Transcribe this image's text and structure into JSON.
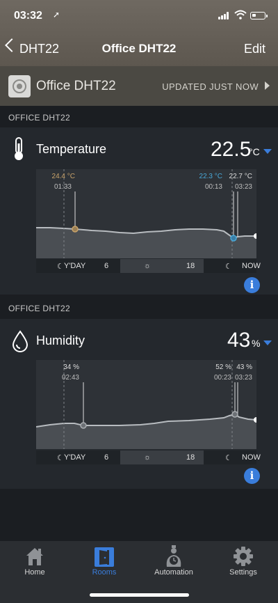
{
  "status": {
    "time": "03:32"
  },
  "nav": {
    "back_label": "DHT22",
    "title": "Office DHT22",
    "edit_label": "Edit"
  },
  "device": {
    "name": "Office DHT22",
    "updated": "UPDATED JUST NOW"
  },
  "temperature": {
    "section_label": "OFFICE DHT22",
    "title": "Temperature",
    "value": "22.5",
    "unit": "°C",
    "markers": [
      {
        "value": "24.4 °C",
        "time": "01:33",
        "color": "#c9a36a"
      },
      {
        "value": "22.3 °C",
        "time": "00:13",
        "color": "#49a8d8"
      },
      {
        "value": "22.7 °C",
        "time": "03:23",
        "color": "#dddddd"
      }
    ],
    "axis": {
      "yday": "Y'DAY",
      "six": "6",
      "eighteen": "18",
      "now": "NOW"
    }
  },
  "humidity": {
    "section_label": "OFFICE DHT22",
    "title": "Humidity",
    "value": "43",
    "unit": "%",
    "markers": [
      {
        "value": "34 %",
        "time": "02:43"
      },
      {
        "value": "52 %",
        "time": "00:23"
      },
      {
        "value": "43 %",
        "time": "03:23"
      }
    ],
    "axis": {
      "yday": "Y'DAY",
      "six": "6",
      "eighteen": "18",
      "now": "NOW"
    }
  },
  "tabs": [
    {
      "label": "Home",
      "icon": "home-icon"
    },
    {
      "label": "Rooms",
      "icon": "rooms-icon"
    },
    {
      "label": "Automation",
      "icon": "automation-icon"
    },
    {
      "label": "Settings",
      "icon": "settings-icon"
    }
  ],
  "colors": {
    "accent": "#3a7ddb",
    "background": "#1b1e22",
    "card": "#24282d"
  }
}
